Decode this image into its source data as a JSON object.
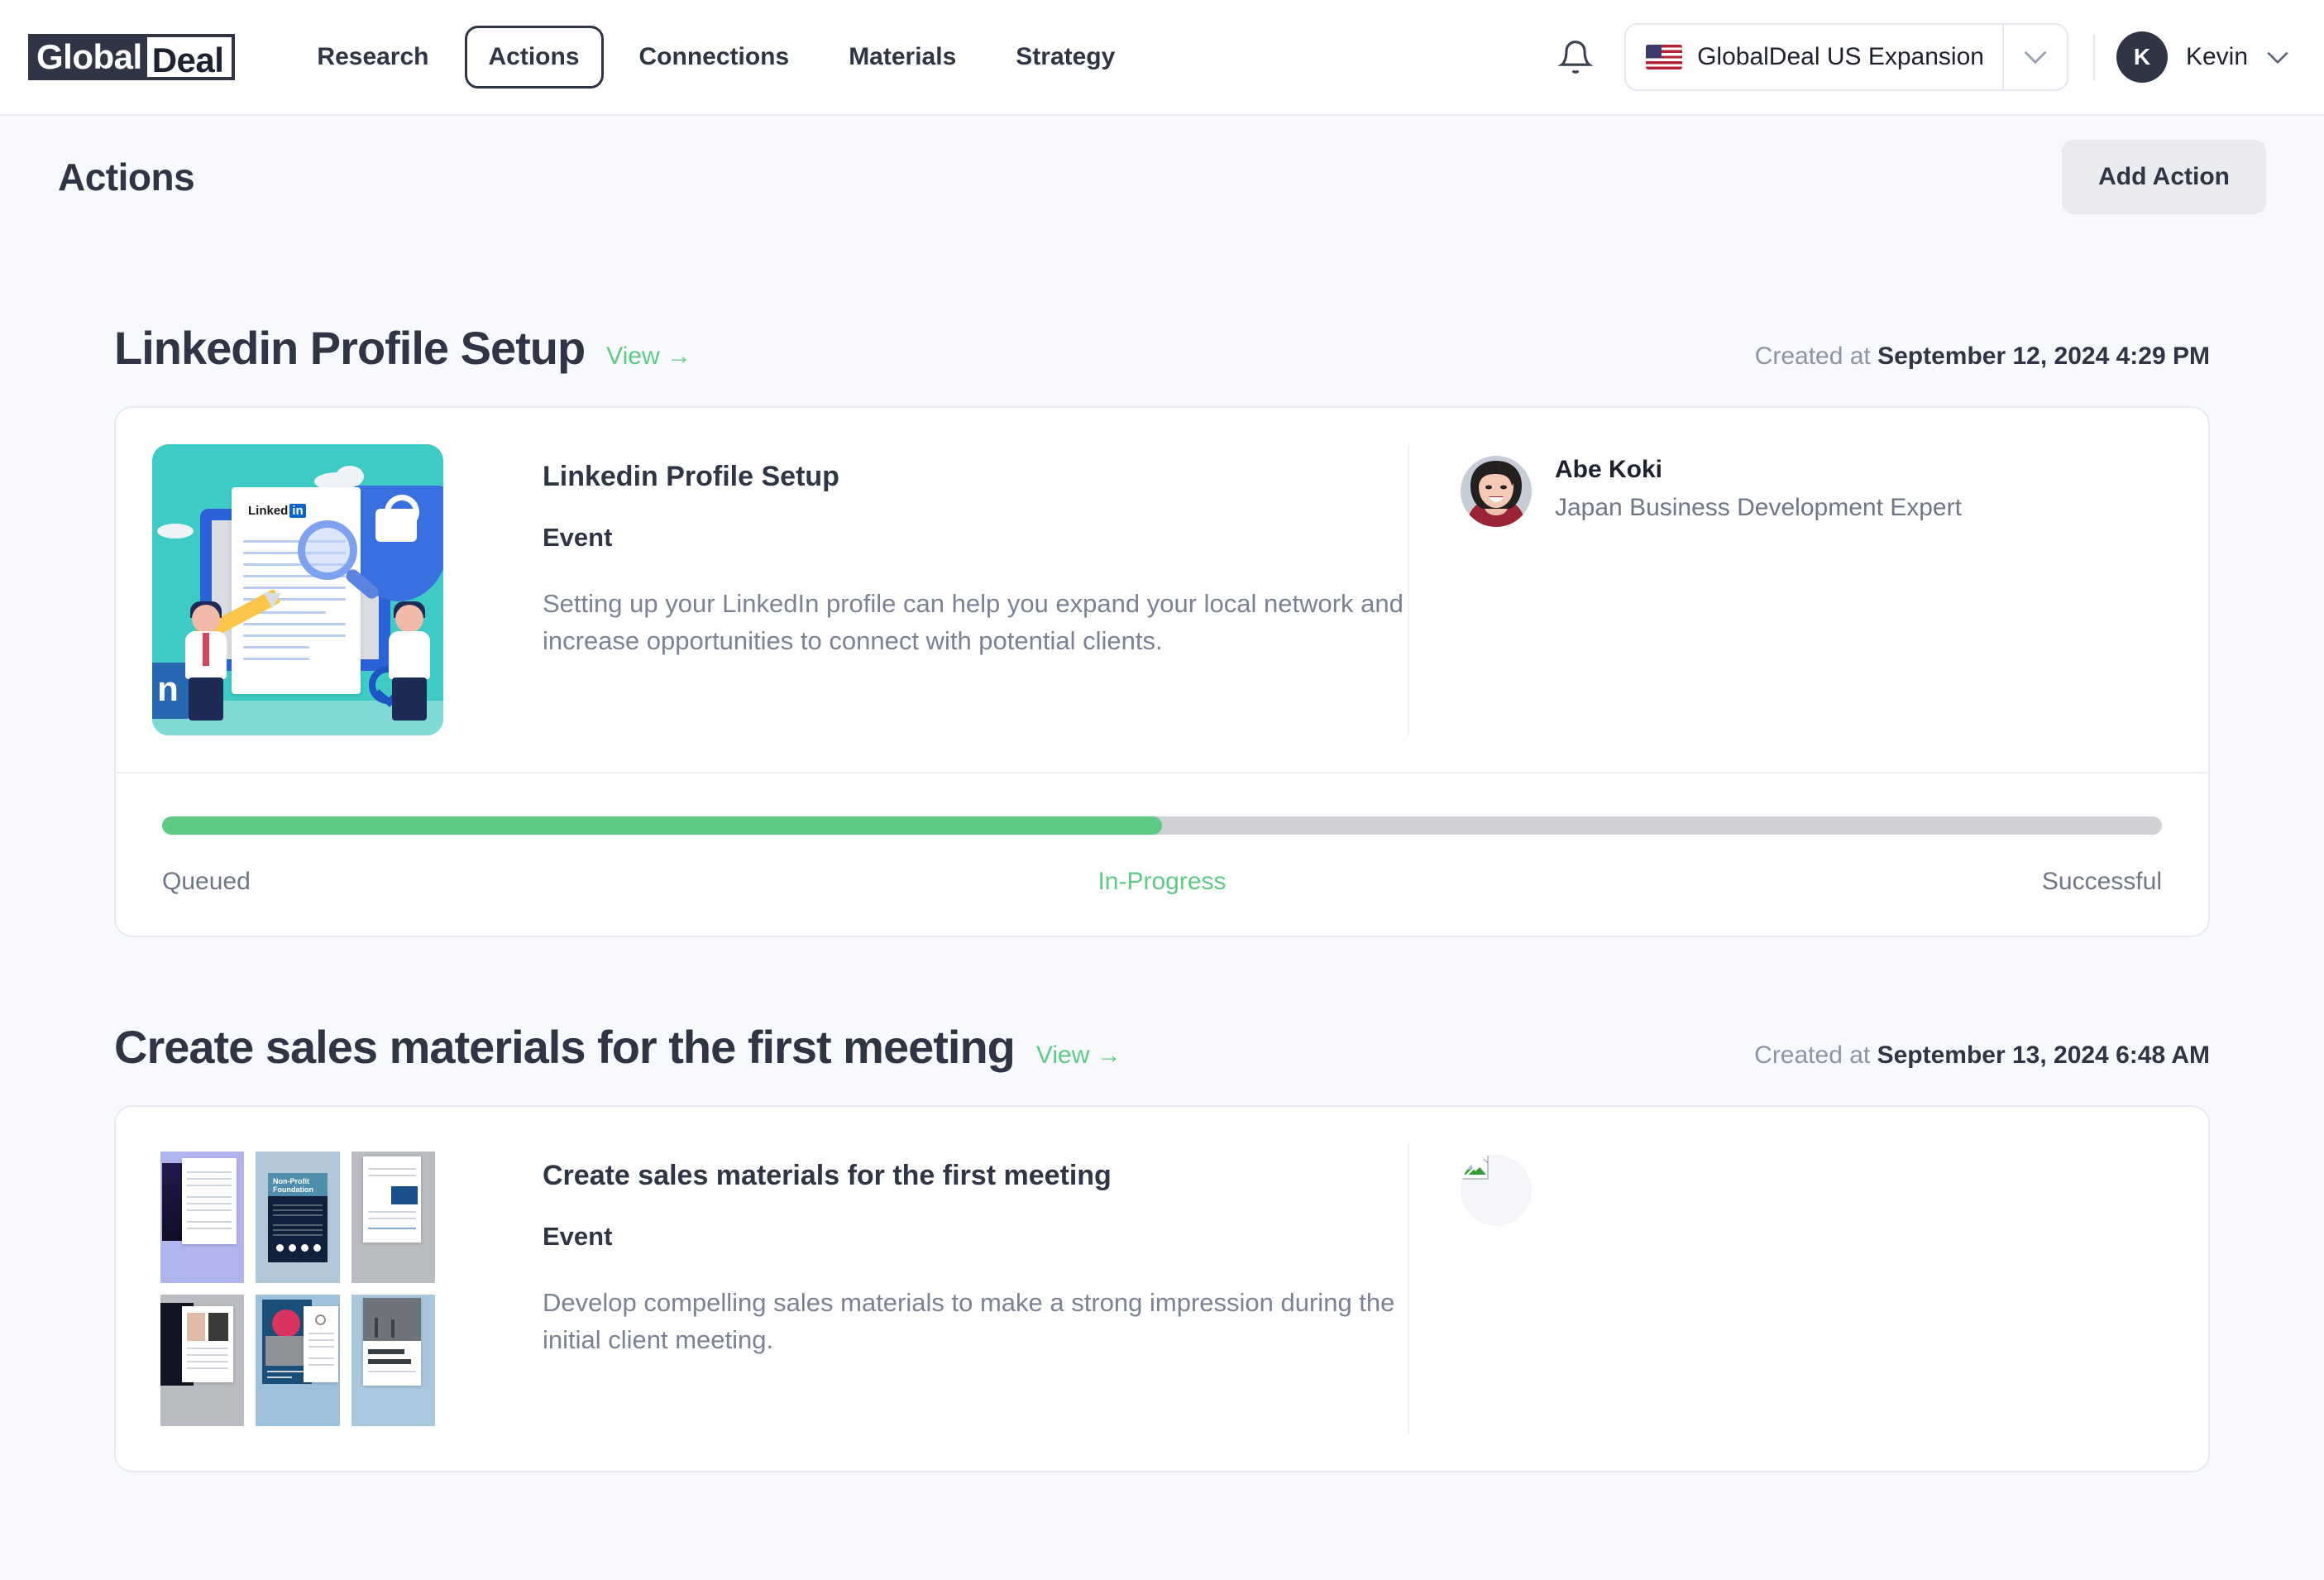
{
  "brand": {
    "part1": "Global",
    "part2": "Deal"
  },
  "nav": {
    "items": [
      {
        "label": "Research",
        "active": false
      },
      {
        "label": "Actions",
        "active": true
      },
      {
        "label": "Connections",
        "active": false
      },
      {
        "label": "Materials",
        "active": false
      },
      {
        "label": "Strategy",
        "active": false
      }
    ]
  },
  "header": {
    "notification_icon": "bell-icon",
    "workspace": {
      "flag": "us-flag-icon",
      "name": "GlobalDeal US Expansion",
      "caret": "chevron-down-icon"
    },
    "user": {
      "initial": "K",
      "name": "Kevin",
      "caret": "chevron-down-icon"
    }
  },
  "page": {
    "title": "Actions",
    "add_action_label": "Add Action"
  },
  "actions": [
    {
      "section_title": "Linkedin Profile Setup",
      "view_label": "View →",
      "created_prefix": "Created at ",
      "created_at": "September 12, 2024 4:29 PM",
      "card_title": "Linkedin Profile Setup",
      "kind": "Event",
      "description": "Setting up your LinkedIn profile can help you expand your local network and increase opportunities to connect with potential clients.",
      "thumbnail": "linkedin-profile-illustration",
      "expert": {
        "name": "Abe Koki",
        "role": "Japan Business Development Expert",
        "avatar": "expert-photo"
      },
      "progress": {
        "percent": 50,
        "fill_color": "#5ecb85",
        "track_color": "#cfd1d4",
        "labels": [
          "Queued",
          "In-Progress",
          "Successful"
        ],
        "active_label": "In-Progress"
      }
    },
    {
      "section_title": "Create sales materials for the first meeting",
      "view_label": "View →",
      "created_prefix": "Created at ",
      "created_at": "September 13, 2024 6:48 AM",
      "card_title": "Create sales materials for the first meeting",
      "kind": "Event",
      "description": "Develop compelling sales materials to make a strong impression during the initial client meeting.",
      "thumbnail": "sales-materials-grid-illustration",
      "expert": {
        "name": "",
        "role": "",
        "avatar": "broken-image-placeholder"
      }
    }
  ],
  "colors": {
    "accent_green": "#5ecb85",
    "ink": "#2f3545",
    "muted": "#7b8294",
    "page_bg": "#f7f9fc"
  }
}
